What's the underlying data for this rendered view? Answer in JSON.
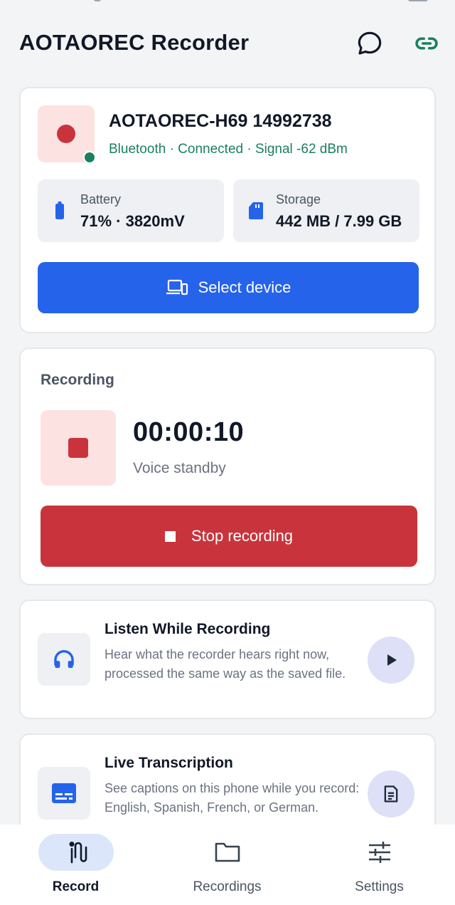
{
  "header": {
    "title": "AOTAOREC Recorder",
    "icons": [
      "chat-bubble-icon",
      "link-icon"
    ]
  },
  "device": {
    "name": "AOTAOREC-H69 14992738",
    "status": "Bluetooth · Connected · Signal -62 dBm",
    "battery": {
      "label": "Battery",
      "value": "71% · 3820mV",
      "icon": "battery-icon"
    },
    "storage": {
      "label": "Storage",
      "value": "442 MB / 7.99 GB",
      "icon": "sd-card-icon"
    },
    "select_button": "Select device"
  },
  "recording": {
    "section_label": "Recording",
    "timer": "00:00:10",
    "state": "Voice standby",
    "stop_button": "Stop recording"
  },
  "features": [
    {
      "title": "Listen While Recording",
      "description": "Hear what the recorder hears right now, processed the same way as the saved file.",
      "icon": "headphones-icon",
      "action_icon": "play-icon"
    },
    {
      "title": "Live Transcription",
      "description": "See captions on this phone while you record: English, Spanish, French, or German.",
      "icon": "captions-icon",
      "action_icon": "document-icon"
    }
  ],
  "nav": {
    "items": [
      {
        "label": "Record",
        "icon": "record-icon",
        "active": true
      },
      {
        "label": "Recordings",
        "icon": "folder-icon",
        "active": false
      },
      {
        "label": "Settings",
        "icon": "sliders-icon",
        "active": false
      }
    ]
  },
  "colors": {
    "primary": "#2563eb",
    "danger": "#c9343c",
    "success": "#1a8060",
    "background": "#f3f4f6",
    "nav_active_pill": "#dbe6fb"
  }
}
